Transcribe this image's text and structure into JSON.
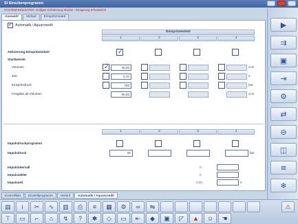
{
  "window": {
    "title": "SI Streckenprogramm",
    "error_line": "SYSTEM-EINLEITEN: Gültiger Einfahrweg-Modus - Einsprung erforderlich"
  },
  "tabs": [
    {
      "label": "Auswahl",
      "active": true
    },
    {
      "label": "Verlauf",
      "active": false
    },
    {
      "label": "Einspritzmodul",
      "active": false
    }
  ],
  "main_toggle": {
    "label": "Automatik / Aquarosedit",
    "checked": true
  },
  "upper": {
    "group_header": "Einspritzeinheit",
    "columns": [
      "1",
      "2",
      "3",
      "4"
    ],
    "activation_label": "Aktivierung Einspritzeinheit",
    "activation_checked": [
      true,
      false,
      false,
      false
    ],
    "section_label": "Startbetrieb",
    "rows": [
      {
        "label": "Volumen",
        "values": [
          "40,00",
          "",
          "",
          ""
        ],
        "checked": [
          true,
          false,
          false,
          false
        ],
        "unit": "ccm"
      },
      {
        "label": "Zeit",
        "values": [
          "0,70",
          "",
          "",
          ""
        ],
        "checked": [
          false,
          false,
          false,
          false
        ],
        "unit": "s"
      },
      {
        "label": "Einspritzdruck",
        "values": [
          "700",
          "",
          "",
          ""
        ],
        "checked": [
          false,
          false,
          false,
          false
        ],
        "unit": "bar"
      },
      {
        "label": "Freigabe ab Volumen",
        "values": [
          "60,00",
          "",
          "",
          ""
        ],
        "checked": [
          false,
          false,
          false,
          false
        ],
        "unit": "ccm"
      }
    ]
  },
  "lower": {
    "columns": [
      "1",
      "2",
      "3",
      "4"
    ],
    "program_label": "Impulsdruckprogramm",
    "pressure_label": "Impulsdruck",
    "pressure_value": "65",
    "pressure_unit": "bar"
  },
  "summary": {
    "rows": [
      {
        "label": "Impulsintervall",
        "value": "0"
      },
      {
        "label": "Impulszähler",
        "value": "0"
      },
      {
        "label": "Impulszeit",
        "value": "0,00"
      }
    ],
    "unit": "s"
  },
  "bottom_tabs": [
    {
      "label": "Kontrollfeld",
      "active": false
    },
    {
      "label": "Einstellprogramm",
      "active": false
    },
    {
      "label": "Verlauf",
      "active": false
    },
    {
      "label": "Automatik / Aquarosedit",
      "active": true
    }
  ],
  "toolbar_icons_row1": [
    "machine-icon",
    "info-icon",
    "tools-icon",
    "chart-icon",
    "stats-icon",
    "print-icon",
    "signal-icon",
    "grid-icon",
    "gear-icon",
    "binoculars-icon",
    "network-icon",
    "blank-icon",
    "blank-icon",
    "blank-icon",
    "blank-icon",
    "blank-icon",
    "blank-icon",
    "warning-icon"
  ],
  "toolbar_icons_row2": [
    "mold-icon",
    "monitor-icon",
    "graph-icon",
    "lock-icon",
    "tool-icon",
    "help-icon",
    "star-icon",
    "diamond-icon",
    "rectangle-icon",
    "move-icon",
    "pin-icon",
    "save-icon",
    "shape-icon",
    "alert-icon",
    "person-icon",
    "hand-icon"
  ],
  "side_icons": [
    "nozzle-icon",
    "screw-icon",
    "mold-icon",
    "injection-icon",
    "robot-icon",
    "dosing-icon",
    "ejector-icon",
    "mold-open-icon",
    "heat-icon",
    "cooling-icon"
  ]
}
